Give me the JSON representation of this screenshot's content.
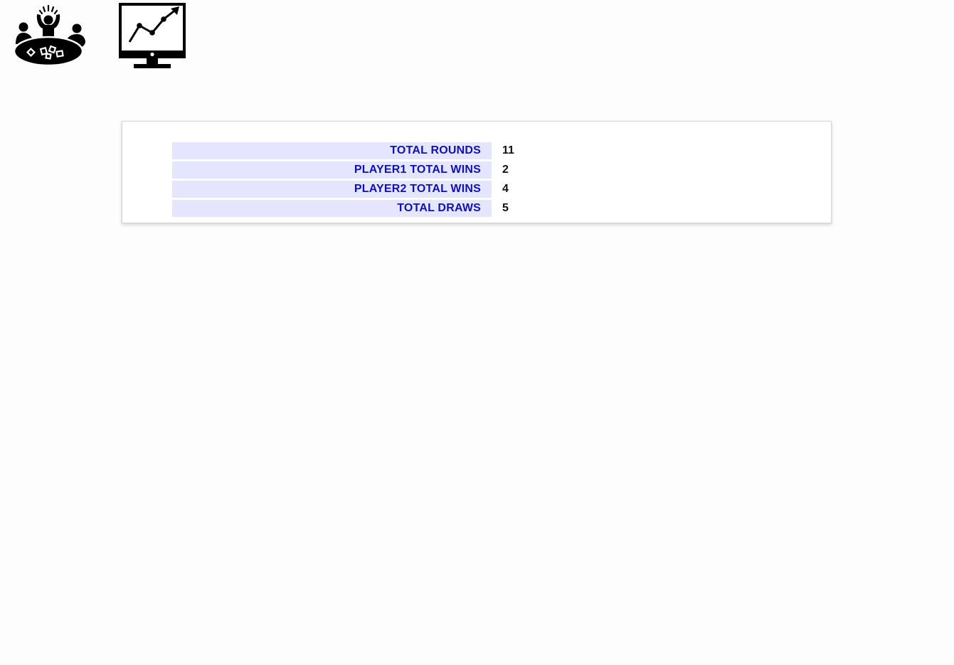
{
  "nav": {
    "game_icon": "card-game-table-icon",
    "stats_icon": "stats-monitor-icon"
  },
  "stats": {
    "rows": [
      {
        "label": "TOTAL ROUNDS",
        "value": "11"
      },
      {
        "label": "PLAYER1 TOTAL WINS",
        "value": "2"
      },
      {
        "label": "PLAYER2 TOTAL WINS",
        "value": "4"
      },
      {
        "label": "TOTAL DRAWS",
        "value": "5"
      }
    ]
  },
  "colors": {
    "label_text": "#1010b4",
    "label_background": "#e4e6fd",
    "value_text": "#111111",
    "icon": "#000000"
  }
}
